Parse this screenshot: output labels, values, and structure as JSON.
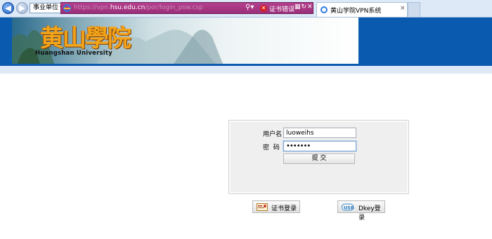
{
  "browser": {
    "favorites_label": "事业单位",
    "address_prefix": "https://vpn.",
    "address_host": "hsu.edu.cn",
    "address_suffix": "/por/login_psw.csp",
    "cert_error": "证书错误",
    "tab_title": "黄山学院VPN系统",
    "tab_close": "×",
    "icons": [
      "back-arrow-icon",
      "forward-arrow-icon",
      "ie-logo-icon",
      "search-icon",
      "error-x-icon",
      "refresh-icon",
      "stop-icon",
      "close-icon"
    ]
  },
  "header": {
    "logo_cn": "黄山學院",
    "logo_en": "Huangshan University",
    "band_color": "#0a5bb0"
  },
  "login": {
    "username_label": "用户名",
    "password_label": "密  码",
    "username_value": "luoweihs",
    "password_value": "•••••••",
    "submit_label": "提 交"
  },
  "alt_login": {
    "cert_label": "证书登录",
    "dkey_label": "Dkey登录"
  }
}
